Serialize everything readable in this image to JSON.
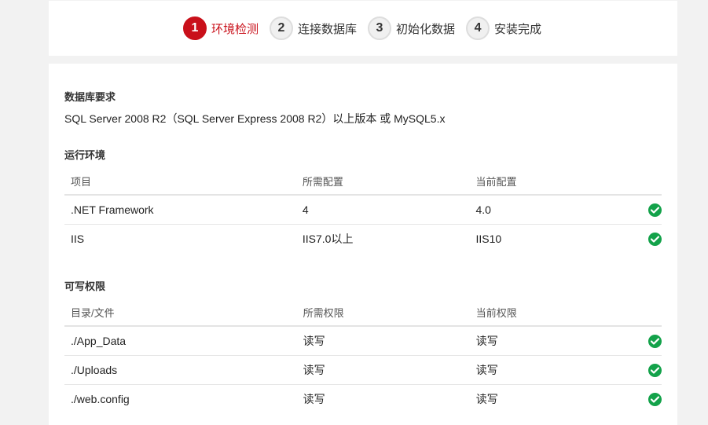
{
  "steps": [
    {
      "num": "1",
      "label": "环境检测",
      "active": true
    },
    {
      "num": "2",
      "label": "连接数据库",
      "active": false
    },
    {
      "num": "3",
      "label": "初始化数据",
      "active": false
    },
    {
      "num": "4",
      "label": "安装完成",
      "active": false
    }
  ],
  "database": {
    "title": "数据库要求",
    "requirement": "SQL Server 2008 R2（SQL Server Express 2008 R2）以上版本 或 MySQL5.x"
  },
  "runtime": {
    "title": "运行环境",
    "headers": [
      "项目",
      "所需配置",
      "当前配置"
    ],
    "rows": [
      {
        "item": ".NET Framework",
        "required": "4",
        "current": "4.0",
        "status_icon": "check-circle-icon"
      },
      {
        "item": "IIS",
        "required": "IIS7.0以上",
        "current": "IIS10",
        "status_icon": "check-circle-icon"
      }
    ]
  },
  "permissions": {
    "title": "可写权限",
    "headers": [
      "目录/文件",
      "所需权限",
      "当前权限"
    ],
    "rows": [
      {
        "item": "./App_Data",
        "required": "读写",
        "current": "读写",
        "status_icon": "check-circle-icon"
      },
      {
        "item": "./Uploads",
        "required": "读写",
        "current": "读写",
        "status_icon": "check-circle-icon"
      },
      {
        "item": "./web.config",
        "required": "读写",
        "current": "读写",
        "status_icon": "check-circle-icon"
      }
    ]
  },
  "colors": {
    "accent": "#c9101a",
    "success": "#13a24a"
  }
}
